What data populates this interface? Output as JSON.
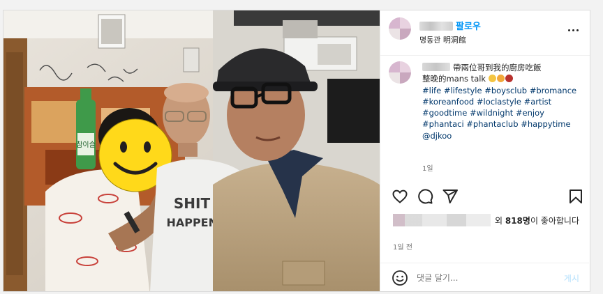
{
  "post": {
    "follow_label": "팔로우",
    "location": "명동관 明洞館",
    "caption": {
      "line1": "帶兩位哥到我的廚房吃飯",
      "line2": "整晚的mans talk",
      "hashtags_row1": [
        "#life",
        "#lifestyle",
        "#boysclub",
        "#bromance"
      ],
      "hashtags_row2": [
        "#koreanfood",
        "#loclastyle",
        "#artist"
      ],
      "hashtags_row3": [
        "#goodtime",
        "#wildnight",
        "#enjoy"
      ],
      "hashtags_row4": [
        "#phantaci",
        "#phantaclub",
        "#happytime"
      ],
      "mention": "@djkoo",
      "time": "1일"
    },
    "likes": {
      "prefix": "외 ",
      "count": "818명",
      "suffix": "이 좋아합니다"
    },
    "time": "1일 전",
    "comment": {
      "placeholder": "댓글 달기...",
      "post_label": "게시"
    },
    "photo_text": {
      "bottle_label": "참이슬",
      "shirt_text_1": "SHIT",
      "shirt_text_2": "HAPPENS"
    },
    "colors": {
      "accent": "#0095f6",
      "hashtag": "#00376b",
      "post_disabled": "#b2dffc"
    },
    "icons": {
      "more": "more-horizontal-icon",
      "like": "heart-icon",
      "comment": "comment-bubble-icon",
      "share": "paper-plane-icon",
      "save": "bookmark-icon",
      "emoji": "emoji-smile-icon"
    }
  }
}
